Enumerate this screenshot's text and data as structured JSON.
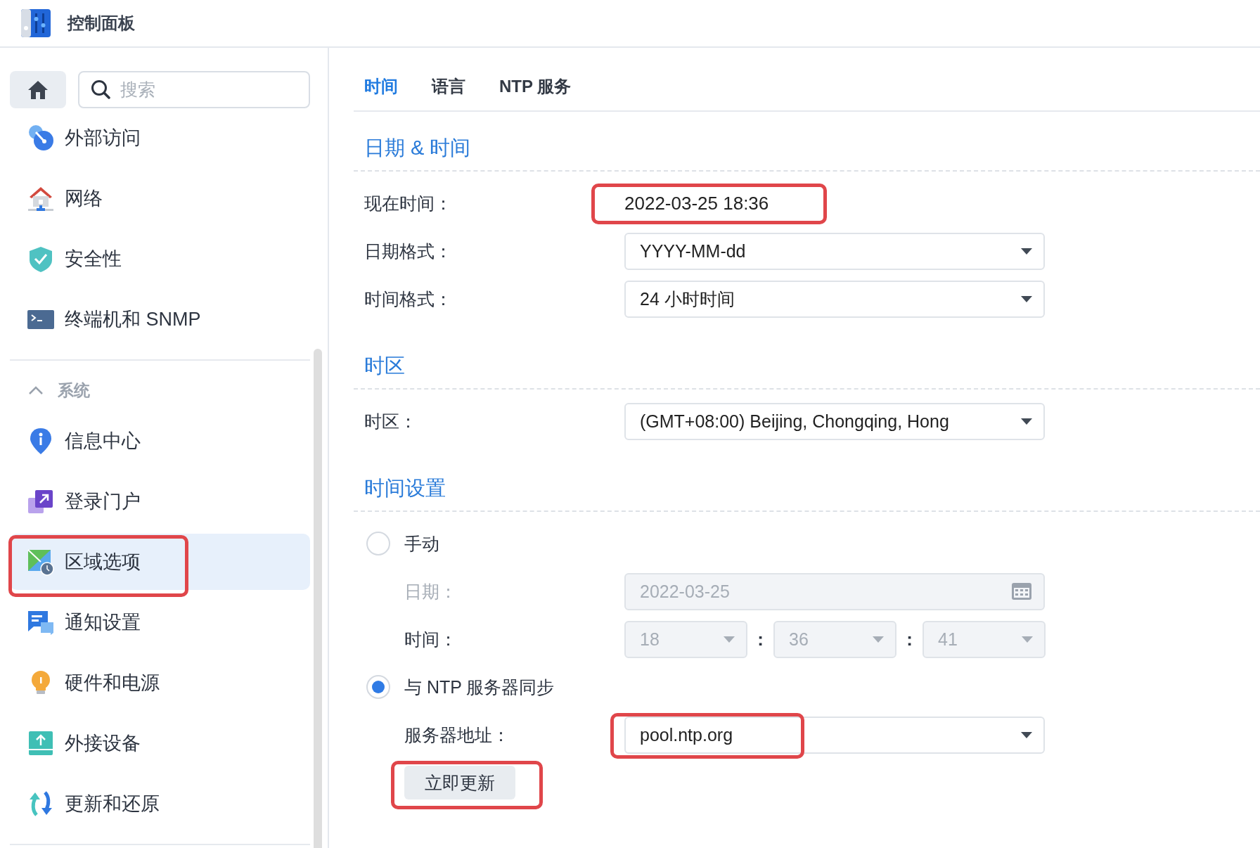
{
  "window": {
    "title": "控制面板"
  },
  "sidebar": {
    "search": {
      "placeholder": "搜索"
    },
    "items": [
      {
        "label": "外部访问",
        "kind": "external-access",
        "selected": false,
        "highlighted": false
      },
      {
        "label": "网络",
        "kind": "network",
        "selected": false,
        "highlighted": false
      },
      {
        "label": "安全性",
        "kind": "security",
        "selected": false,
        "highlighted": false
      },
      {
        "label": "终端机和 SNMP",
        "kind": "terminal",
        "selected": false,
        "highlighted": false
      }
    ],
    "group": {
      "label": "系统",
      "expanded": true,
      "items": [
        {
          "label": "信息中心",
          "kind": "info",
          "selected": false,
          "highlighted": false
        },
        {
          "label": "登录门户",
          "kind": "login-portal",
          "selected": false,
          "highlighted": false
        },
        {
          "label": "区域选项",
          "kind": "regional",
          "selected": true,
          "highlighted": true
        },
        {
          "label": "通知设置",
          "kind": "notification",
          "selected": false,
          "highlighted": false
        },
        {
          "label": "硬件和电源",
          "kind": "hardware",
          "selected": false,
          "highlighted": false
        },
        {
          "label": "外接设备",
          "kind": "external-devices",
          "selected": false,
          "highlighted": false
        },
        {
          "label": "更新和还原",
          "kind": "update",
          "selected": false,
          "highlighted": false
        }
      ]
    }
  },
  "main": {
    "tabs": [
      {
        "label": "时间",
        "selected": true
      },
      {
        "label": "语言",
        "selected": false
      },
      {
        "label": "NTP 服务",
        "selected": false
      }
    ],
    "sections": [
      {
        "title": "日期 & 时间",
        "rows": [
          {
            "kind": "text",
            "label": "现在时间：",
            "value": "2022-03-25 18:36",
            "highlighted": true
          },
          {
            "kind": "select",
            "label": "日期格式：",
            "value": "YYYY-MM-dd",
            "disabled": false,
            "highlighted": false
          },
          {
            "kind": "select",
            "label": "时间格式：",
            "value": "24 小时时间",
            "disabled": false,
            "highlighted": false
          }
        ]
      },
      {
        "title": "时区",
        "rows": [
          {
            "kind": "select",
            "label": "时区：",
            "value": "(GMT+08:00) Beijing, Chongqing, Hong",
            "disabled": false,
            "highlighted": false
          }
        ]
      },
      {
        "title": "时间设置",
        "rows": [
          {
            "kind": "radio",
            "label": "手动",
            "selected": false,
            "children": [
              {
                "kind": "date",
                "label": "日期：",
                "value": "2022-03-25",
                "label_disabled": true,
                "disabled": true
              },
              {
                "kind": "time",
                "label": "时间：",
                "values": [
                  "18",
                  "36",
                  "41"
                ],
                "separators": [
                  ":",
                  ":"
                ],
                "label_disabled": false,
                "disabled": true
              }
            ]
          },
          {
            "kind": "radio",
            "label": "与 NTP 服务器同步",
            "selected": true,
            "children": [
              {
                "kind": "select",
                "label": "服务器地址：",
                "value": "pool.ntp.org",
                "disabled": false,
                "highlighted": true
              },
              {
                "kind": "button",
                "label": "立即更新",
                "highlighted": true
              }
            ]
          }
        ]
      }
    ]
  }
}
